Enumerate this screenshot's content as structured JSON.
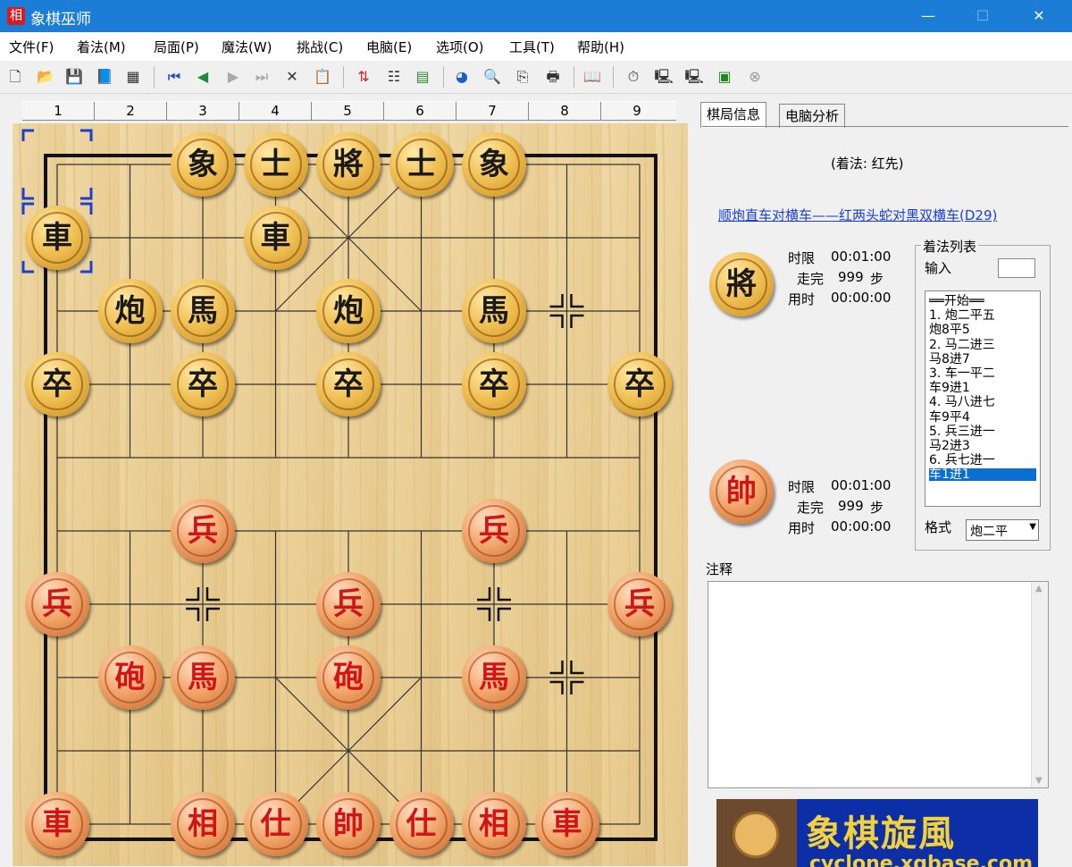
{
  "window": {
    "title": "象棋巫师",
    "app_icon_char": "相",
    "minimize": "—",
    "maximize": "☐",
    "close": "✕"
  },
  "menu": [
    "文件(F)",
    "着法(M)",
    "局面(P)",
    "魔法(W)",
    "挑战(C)",
    "电脑(E)",
    "选项(O)",
    "工具(T)",
    "帮助(H)"
  ],
  "toolbar_icons": [
    "new-file-icon",
    "open-folder-icon",
    "save-icon",
    "book-icon",
    "properties-icon",
    "first-move-icon",
    "prev-move-icon",
    "next-move-icon",
    "last-move-icon",
    "delete-icon",
    "paste-icon",
    "flip-board-icon",
    "move-tree-icon",
    "eval-grid-icon",
    "engine-color-icon",
    "analyze-icon",
    "export-icon",
    "print-icon",
    "opening-book-icon",
    "clock-icon",
    "computer-icon",
    "computer2-icon",
    "monitor-icon",
    "stop-icon"
  ],
  "board": {
    "file_labels": [
      "1",
      "2",
      "3",
      "4",
      "5",
      "6",
      "7",
      "8",
      "9"
    ],
    "pieces": [
      {
        "side": "black",
        "char": "象",
        "file": 3,
        "rank": 0
      },
      {
        "side": "black",
        "char": "士",
        "file": 4,
        "rank": 0
      },
      {
        "side": "black",
        "char": "將",
        "file": 5,
        "rank": 0
      },
      {
        "side": "black",
        "char": "士",
        "file": 6,
        "rank": 0
      },
      {
        "side": "black",
        "char": "象",
        "file": 7,
        "rank": 0
      },
      {
        "side": "black",
        "char": "車",
        "file": 1,
        "rank": 1
      },
      {
        "side": "black",
        "char": "車",
        "file": 4,
        "rank": 1
      },
      {
        "side": "black",
        "char": "炮",
        "file": 2,
        "rank": 2
      },
      {
        "side": "black",
        "char": "馬",
        "file": 3,
        "rank": 2
      },
      {
        "side": "black",
        "char": "炮",
        "file": 5,
        "rank": 2
      },
      {
        "side": "black",
        "char": "馬",
        "file": 7,
        "rank": 2
      },
      {
        "side": "black",
        "char": "卒",
        "file": 1,
        "rank": 3
      },
      {
        "side": "black",
        "char": "卒",
        "file": 3,
        "rank": 3
      },
      {
        "side": "black",
        "char": "卒",
        "file": 5,
        "rank": 3
      },
      {
        "side": "black",
        "char": "卒",
        "file": 7,
        "rank": 3
      },
      {
        "side": "black",
        "char": "卒",
        "file": 9,
        "rank": 3
      },
      {
        "side": "red",
        "char": "兵",
        "file": 3,
        "rank": 5
      },
      {
        "side": "red",
        "char": "兵",
        "file": 7,
        "rank": 5
      },
      {
        "side": "red",
        "char": "兵",
        "file": 1,
        "rank": 6
      },
      {
        "side": "red",
        "char": "兵",
        "file": 5,
        "rank": 6
      },
      {
        "side": "red",
        "char": "兵",
        "file": 9,
        "rank": 6
      },
      {
        "side": "red",
        "char": "砲",
        "file": 2,
        "rank": 7
      },
      {
        "side": "red",
        "char": "馬",
        "file": 3,
        "rank": 7
      },
      {
        "side": "red",
        "char": "砲",
        "file": 5,
        "rank": 7
      },
      {
        "side": "red",
        "char": "馬",
        "file": 7,
        "rank": 7
      },
      {
        "side": "red",
        "char": "車",
        "file": 1,
        "rank": 9
      },
      {
        "side": "red",
        "char": "相",
        "file": 3,
        "rank": 9
      },
      {
        "side": "red",
        "char": "仕",
        "file": 4,
        "rank": 9
      },
      {
        "side": "red",
        "char": "帥",
        "file": 5,
        "rank": 9
      },
      {
        "side": "red",
        "char": "仕",
        "file": 6,
        "rank": 9
      },
      {
        "side": "red",
        "char": "相",
        "file": 7,
        "rank": 9
      },
      {
        "side": "red",
        "char": "車",
        "file": 8,
        "rank": 9
      }
    ],
    "empty_markers": [
      {
        "file": 8,
        "rank": 2
      },
      {
        "file": 3,
        "rank": 6
      },
      {
        "file": 7,
        "rank": 6
      },
      {
        "file": 8,
        "rank": 7
      }
    ],
    "selected": {
      "file": 1,
      "rank": 1
    },
    "last_from": {
      "file": 1,
      "rank": 0
    }
  },
  "panel": {
    "tabs": [
      "棋局信息",
      "电脑分析"
    ],
    "move_hint": "(着法: 红先)",
    "opening_link": "顺炮直车对横车——红两头蛇对黑双横车(D29)",
    "black_player": {
      "piece_char": "將",
      "time_limit_label": "时限",
      "time_limit": "00:01:00",
      "finish_label": "走完",
      "finish_moves": "999",
      "moves_unit": "步",
      "used_label": "用时",
      "used_time": "00:00:00"
    },
    "red_player": {
      "piece_char": "帥",
      "time_limit_label": "时限",
      "time_limit": "00:01:00",
      "finish_label": "走完",
      "finish_moves": "999",
      "moves_unit": "步",
      "used_label": "用时",
      "used_time": "00:00:00"
    },
    "move_list": {
      "title": "着法列表",
      "input_label": "输入",
      "input_value": "",
      "items": [
        "══开始══",
        "1. 炮二平五",
        "   炮8平5",
        "2. 马二进三",
        "   马8进7",
        "3. 车一平二",
        "   车9进1",
        "4. 马八进七",
        "   车9平4",
        "5. 兵三进一",
        "   马2进3",
        "6. 兵七进一",
        "   车1进1"
      ],
      "selected_index": 12,
      "format_label": "格式",
      "format_value": "炮二平"
    },
    "notes_label": "注释",
    "banner_text": "象棋旋風",
    "banner_sub": "cyclone.xqbase.com",
    "banner_colors": {
      "bg": "#0c2fa8",
      "text": "#f4d13a"
    }
  }
}
